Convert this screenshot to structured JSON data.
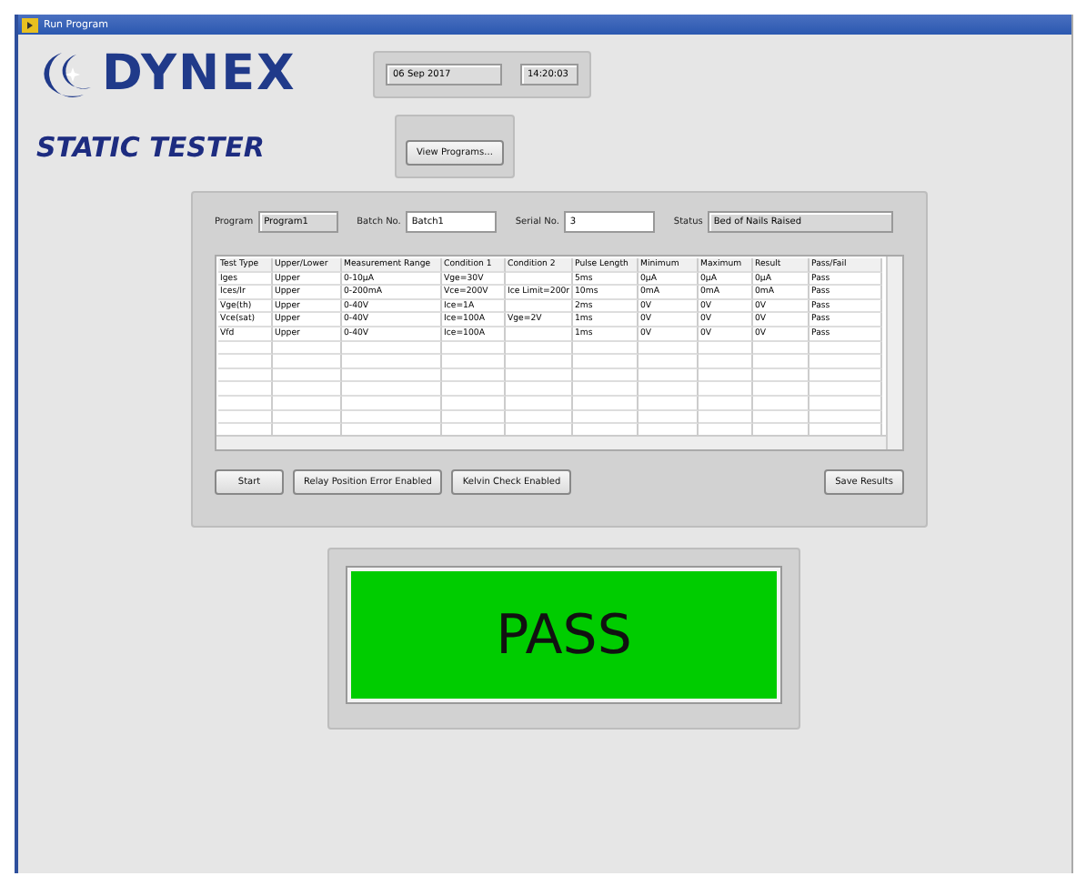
{
  "window": {
    "title": "Run Program"
  },
  "logo": {
    "text": "DYNEX"
  },
  "app_title": "STATIC TESTER",
  "date": "06 Sep 2017",
  "time": "14:20:03",
  "view_button": "View Programs...",
  "fields": [
    {
      "label": "Program",
      "value": "Program1",
      "editable": false
    },
    {
      "label": "Batch No.",
      "value": "Batch1",
      "editable": true
    },
    {
      "label": "Serial No.",
      "value": "3",
      "editable": true
    },
    {
      "label": "Status",
      "value": "Bed of Nails Raised",
      "editable": false
    }
  ],
  "table": {
    "columns": [
      "Test Type",
      "Upper/Lower",
      "Measurement Range",
      "Condition 1",
      "Condition 2",
      "Pulse Length",
      "Minimum",
      "Maximum",
      "Result",
      "Pass/Fail"
    ],
    "rows": [
      [
        "Iges",
        "Upper",
        "0-10µA",
        "Vge=30V",
        "",
        "5ms",
        "0µA",
        "0µA",
        "0µA",
        "Pass"
      ],
      [
        "Ices/Ir",
        "Upper",
        "0-200mA",
        "Vce=200V",
        "Ice Limit=200r",
        "10ms",
        "0mA",
        "0mA",
        "0mA",
        "Pass"
      ],
      [
        "Vge(th)",
        "Upper",
        "0-40V",
        "Ice=1A",
        "",
        "2ms",
        "0V",
        "0V",
        "0V",
        "Pass"
      ],
      [
        "Vce(sat)",
        "Upper",
        "0-40V",
        "Ice=100A",
        "Vge=2V",
        "1ms",
        "0V",
        "0V",
        "0V",
        "Pass"
      ],
      [
        "Vfd",
        "Upper",
        "0-40V",
        "Ice=100A",
        "",
        "1ms",
        "0V",
        "0V",
        "0V",
        "Pass"
      ]
    ]
  },
  "buttons": [
    "Start",
    "Relay Position Error Enabled",
    "Kelvin Check Enabled"
  ],
  "save_button": "Save Results",
  "result": {
    "text": "PASS",
    "passed": true
  }
}
